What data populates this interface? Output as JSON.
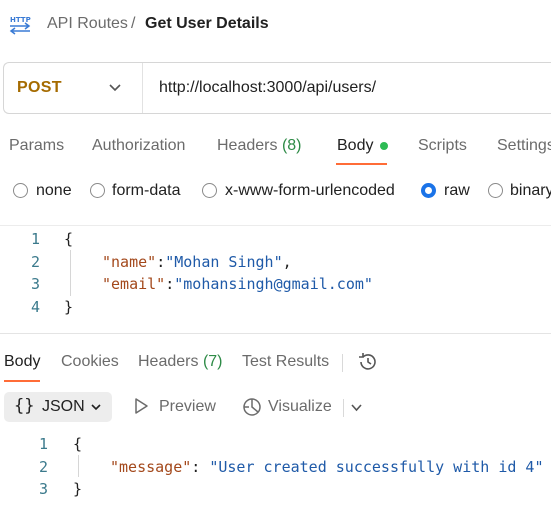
{
  "header": {
    "icon": "http-icon",
    "parent": "API Routes",
    "separator": "/",
    "current": "Get User Details"
  },
  "request": {
    "method": "POST",
    "url": "http://localhost:3000/api/users/"
  },
  "request_tabs": [
    {
      "label": "Params"
    },
    {
      "label": "Authorization"
    },
    {
      "label": "Headers",
      "count": "(8)"
    },
    {
      "label": "Body",
      "active": true
    },
    {
      "label": "Scripts"
    },
    {
      "label": "Settings"
    }
  ],
  "body_types": [
    {
      "label": "none",
      "checked": false
    },
    {
      "label": "form-data",
      "checked": false
    },
    {
      "label": "x-www-form-urlencoded",
      "checked": false
    },
    {
      "label": "raw",
      "checked": true
    },
    {
      "label": "binary",
      "checked": false
    }
  ],
  "request_body": {
    "line_numbers": [
      "1",
      "2",
      "3",
      "4"
    ],
    "open_brace": "{",
    "name_key": "\"name\"",
    "name_value": "\"Mohan Singh\"",
    "email_key": "\"email\"",
    "email_value": "\"mohansingh@gmail.com\"",
    "close_brace": "}"
  },
  "response_tabs": [
    {
      "label": "Body",
      "active": true
    },
    {
      "label": "Cookies"
    },
    {
      "label": "Headers",
      "count": "(7)"
    },
    {
      "label": "Test Results"
    }
  ],
  "response_toolbar": {
    "format_braces": "{}",
    "format": "JSON",
    "preview": "Preview",
    "visualize": "Visualize"
  },
  "response_body": {
    "line_numbers": [
      "1",
      "2",
      "3"
    ],
    "open_brace": "{",
    "message_key": "\"message\"",
    "message_value": "\"User created successfully with id 4\"",
    "close_brace": "}"
  },
  "colors": {
    "accent": "#ff6c37",
    "method_post": "#a56b00",
    "radio_checked": "#1a73e8",
    "body_dot": "#2dbb54",
    "count_green": "#2e8b47"
  }
}
